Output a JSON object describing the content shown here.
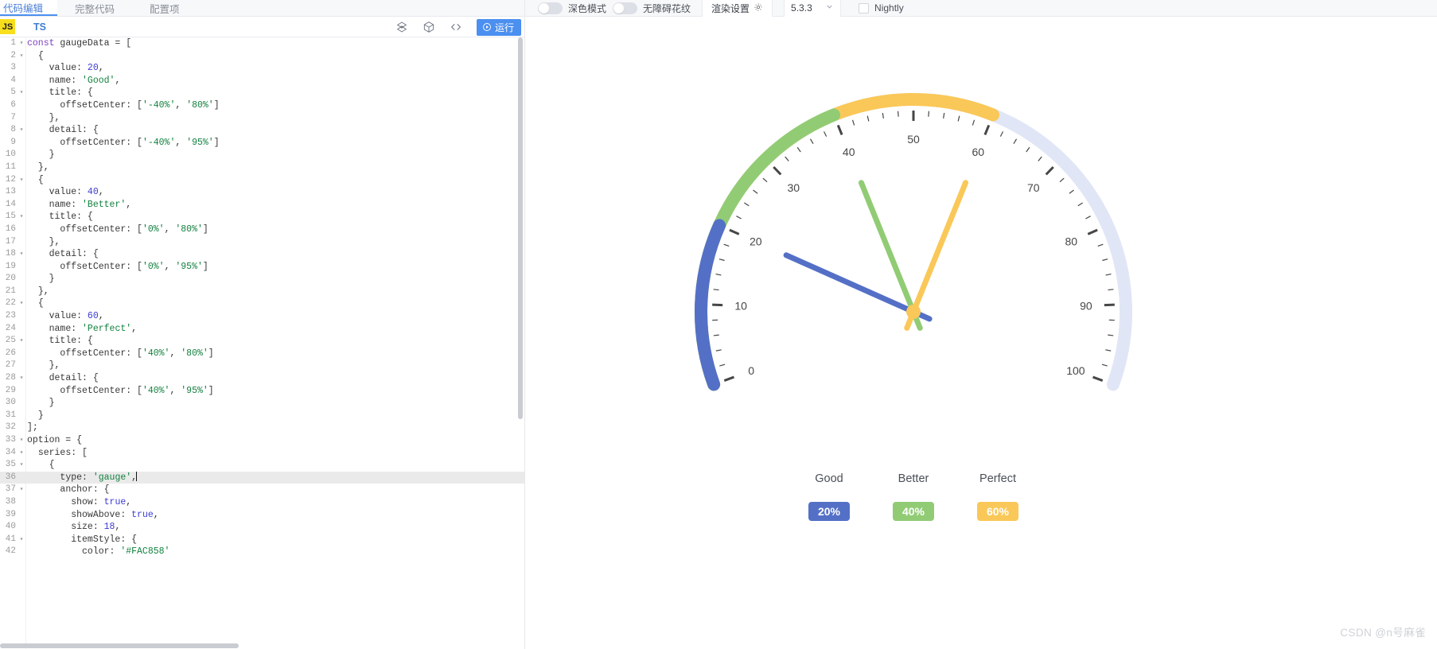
{
  "editor": {
    "tabs": [
      {
        "label": "代码编辑",
        "active": true
      },
      {
        "label": "完整代码",
        "active": false
      },
      {
        "label": "配置项",
        "active": false
      }
    ],
    "lang_js": "JS",
    "lang_ts": "TS",
    "icons": [
      "palette-icon",
      "cube-icon",
      "code-brackets-icon"
    ],
    "run_label": "运行",
    "code_lines": [
      {
        "n": 1,
        "fold": true,
        "indent": 0,
        "tokens": [
          [
            "key",
            "const"
          ],
          [
            "plain",
            " gaugeData = ["
          ]
        ]
      },
      {
        "n": 2,
        "fold": true,
        "indent": 1,
        "tokens": [
          [
            "plain",
            "{"
          ]
        ]
      },
      {
        "n": 3,
        "fold": false,
        "indent": 2,
        "tokens": [
          [
            "plain",
            "value: "
          ],
          [
            "num",
            "20"
          ],
          [
            "plain",
            ","
          ]
        ]
      },
      {
        "n": 4,
        "fold": false,
        "indent": 2,
        "tokens": [
          [
            "plain",
            "name: "
          ],
          [
            "str",
            "'Good'"
          ],
          [
            "plain",
            ","
          ]
        ]
      },
      {
        "n": 5,
        "fold": true,
        "indent": 2,
        "tokens": [
          [
            "plain",
            "title: {"
          ]
        ]
      },
      {
        "n": 6,
        "fold": false,
        "indent": 3,
        "tokens": [
          [
            "plain",
            "offsetCenter: ["
          ],
          [
            "str",
            "'-40%'"
          ],
          [
            "plain",
            ", "
          ],
          [
            "str",
            "'80%'"
          ],
          [
            "plain",
            "]"
          ]
        ]
      },
      {
        "n": 7,
        "fold": false,
        "indent": 2,
        "tokens": [
          [
            "plain",
            "},"
          ]
        ]
      },
      {
        "n": 8,
        "fold": true,
        "indent": 2,
        "tokens": [
          [
            "plain",
            "detail: {"
          ]
        ]
      },
      {
        "n": 9,
        "fold": false,
        "indent": 3,
        "tokens": [
          [
            "plain",
            "offsetCenter: ["
          ],
          [
            "str",
            "'-40%'"
          ],
          [
            "plain",
            ", "
          ],
          [
            "str",
            "'95%'"
          ],
          [
            "plain",
            "]"
          ]
        ]
      },
      {
        "n": 10,
        "fold": false,
        "indent": 2,
        "tokens": [
          [
            "plain",
            "}"
          ]
        ]
      },
      {
        "n": 11,
        "fold": false,
        "indent": 1,
        "tokens": [
          [
            "plain",
            "},"
          ]
        ]
      },
      {
        "n": 12,
        "fold": true,
        "indent": 1,
        "tokens": [
          [
            "plain",
            "{"
          ]
        ]
      },
      {
        "n": 13,
        "fold": false,
        "indent": 2,
        "tokens": [
          [
            "plain",
            "value: "
          ],
          [
            "num",
            "40"
          ],
          [
            "plain",
            ","
          ]
        ]
      },
      {
        "n": 14,
        "fold": false,
        "indent": 2,
        "tokens": [
          [
            "plain",
            "name: "
          ],
          [
            "str",
            "'Better'"
          ],
          [
            "plain",
            ","
          ]
        ]
      },
      {
        "n": 15,
        "fold": true,
        "indent": 2,
        "tokens": [
          [
            "plain",
            "title: {"
          ]
        ]
      },
      {
        "n": 16,
        "fold": false,
        "indent": 3,
        "tokens": [
          [
            "plain",
            "offsetCenter: ["
          ],
          [
            "str",
            "'0%'"
          ],
          [
            "plain",
            ", "
          ],
          [
            "str",
            "'80%'"
          ],
          [
            "plain",
            "]"
          ]
        ]
      },
      {
        "n": 17,
        "fold": false,
        "indent": 2,
        "tokens": [
          [
            "plain",
            "},"
          ]
        ]
      },
      {
        "n": 18,
        "fold": true,
        "indent": 2,
        "tokens": [
          [
            "plain",
            "detail: {"
          ]
        ]
      },
      {
        "n": 19,
        "fold": false,
        "indent": 3,
        "tokens": [
          [
            "plain",
            "offsetCenter: ["
          ],
          [
            "str",
            "'0%'"
          ],
          [
            "plain",
            ", "
          ],
          [
            "str",
            "'95%'"
          ],
          [
            "plain",
            "]"
          ]
        ]
      },
      {
        "n": 20,
        "fold": false,
        "indent": 2,
        "tokens": [
          [
            "plain",
            "}"
          ]
        ]
      },
      {
        "n": 21,
        "fold": false,
        "indent": 1,
        "tokens": [
          [
            "plain",
            "},"
          ]
        ]
      },
      {
        "n": 22,
        "fold": true,
        "indent": 1,
        "tokens": [
          [
            "plain",
            "{"
          ]
        ]
      },
      {
        "n": 23,
        "fold": false,
        "indent": 2,
        "tokens": [
          [
            "plain",
            "value: "
          ],
          [
            "num",
            "60"
          ],
          [
            "plain",
            ","
          ]
        ]
      },
      {
        "n": 24,
        "fold": false,
        "indent": 2,
        "tokens": [
          [
            "plain",
            "name: "
          ],
          [
            "str",
            "'Perfect'"
          ],
          [
            "plain",
            ","
          ]
        ]
      },
      {
        "n": 25,
        "fold": true,
        "indent": 2,
        "tokens": [
          [
            "plain",
            "title: {"
          ]
        ]
      },
      {
        "n": 26,
        "fold": false,
        "indent": 3,
        "tokens": [
          [
            "plain",
            "offsetCenter: ["
          ],
          [
            "str",
            "'40%'"
          ],
          [
            "plain",
            ", "
          ],
          [
            "str",
            "'80%'"
          ],
          [
            "plain",
            "]"
          ]
        ]
      },
      {
        "n": 27,
        "fold": false,
        "indent": 2,
        "tokens": [
          [
            "plain",
            "},"
          ]
        ]
      },
      {
        "n": 28,
        "fold": true,
        "indent": 2,
        "tokens": [
          [
            "plain",
            "detail: {"
          ]
        ]
      },
      {
        "n": 29,
        "fold": false,
        "indent": 3,
        "tokens": [
          [
            "plain",
            "offsetCenter: ["
          ],
          [
            "str",
            "'40%'"
          ],
          [
            "plain",
            ", "
          ],
          [
            "str",
            "'95%'"
          ],
          [
            "plain",
            "]"
          ]
        ]
      },
      {
        "n": 30,
        "fold": false,
        "indent": 2,
        "tokens": [
          [
            "plain",
            "}"
          ]
        ]
      },
      {
        "n": 31,
        "fold": false,
        "indent": 1,
        "tokens": [
          [
            "plain",
            "}"
          ]
        ]
      },
      {
        "n": 32,
        "fold": false,
        "indent": 0,
        "tokens": [
          [
            "plain",
            "];"
          ]
        ]
      },
      {
        "n": 33,
        "fold": true,
        "indent": 0,
        "tokens": [
          [
            "plain",
            "option = {"
          ]
        ]
      },
      {
        "n": 34,
        "fold": true,
        "indent": 1,
        "tokens": [
          [
            "plain",
            "series: ["
          ]
        ]
      },
      {
        "n": 35,
        "fold": true,
        "indent": 2,
        "tokens": [
          [
            "plain",
            "{"
          ]
        ]
      },
      {
        "n": 36,
        "fold": false,
        "indent": 3,
        "current": true,
        "caret": true,
        "tokens": [
          [
            "plain",
            "type: "
          ],
          [
            "str",
            "'gauge'"
          ],
          [
            "plain",
            ","
          ]
        ]
      },
      {
        "n": 37,
        "fold": true,
        "indent": 3,
        "tokens": [
          [
            "plain",
            "anchor: {"
          ]
        ]
      },
      {
        "n": 38,
        "fold": false,
        "indent": 4,
        "tokens": [
          [
            "plain",
            "show: "
          ],
          [
            "num",
            "true"
          ],
          [
            "plain",
            ","
          ]
        ]
      },
      {
        "n": 39,
        "fold": false,
        "indent": 4,
        "tokens": [
          [
            "plain",
            "showAbove: "
          ],
          [
            "num",
            "true"
          ],
          [
            "plain",
            ","
          ]
        ]
      },
      {
        "n": 40,
        "fold": false,
        "indent": 4,
        "tokens": [
          [
            "plain",
            "size: "
          ],
          [
            "num",
            "18"
          ],
          [
            "plain",
            ","
          ]
        ]
      },
      {
        "n": 41,
        "fold": true,
        "indent": 4,
        "tokens": [
          [
            "plain",
            "itemStyle: {"
          ]
        ]
      },
      {
        "n": 42,
        "fold": false,
        "indent": 5,
        "tokens": [
          [
            "plain",
            "color: "
          ],
          [
            "str",
            "'#FAC858'"
          ]
        ]
      }
    ]
  },
  "preview": {
    "dark_mode_label": "深色模式",
    "accessible_label": "无障碍花纹",
    "render_settings_label": "渲染设置",
    "version": "5.3.3",
    "nightly_label": "Nightly",
    "dark_mode_on": false,
    "accessible_on": false,
    "nightly_checked": false
  },
  "watermark": "CSDN @n号麻雀",
  "chart_data": {
    "type": "gauge",
    "title": "",
    "axis": {
      "min": 0,
      "max": 100,
      "start_angle": 200,
      "end_angle": -20,
      "tick_labels": [
        0,
        10,
        20,
        30,
        40,
        50,
        60,
        70,
        80,
        90,
        100
      ],
      "split_number": 10,
      "minor_ticks_per_split": 5
    },
    "series": [
      {
        "name": "Good",
        "value": 20,
        "detail": "20%",
        "color": "#5470C6"
      },
      {
        "name": "Better",
        "value": 40,
        "detail": "40%",
        "color": "#91CC75"
      },
      {
        "name": "Perfect",
        "value": 60,
        "detail": "60%",
        "color": "#FAC858"
      }
    ],
    "progress_track_color": "#E0E6F6",
    "anchor_color": "#FAC858",
    "tick_label_color": "#464646",
    "title_color": "#4a4f57",
    "legend_position": "bottom",
    "titles": [
      "Good",
      "Better",
      "Perfect"
    ],
    "details": [
      "20%",
      "40%",
      "60%"
    ]
  }
}
